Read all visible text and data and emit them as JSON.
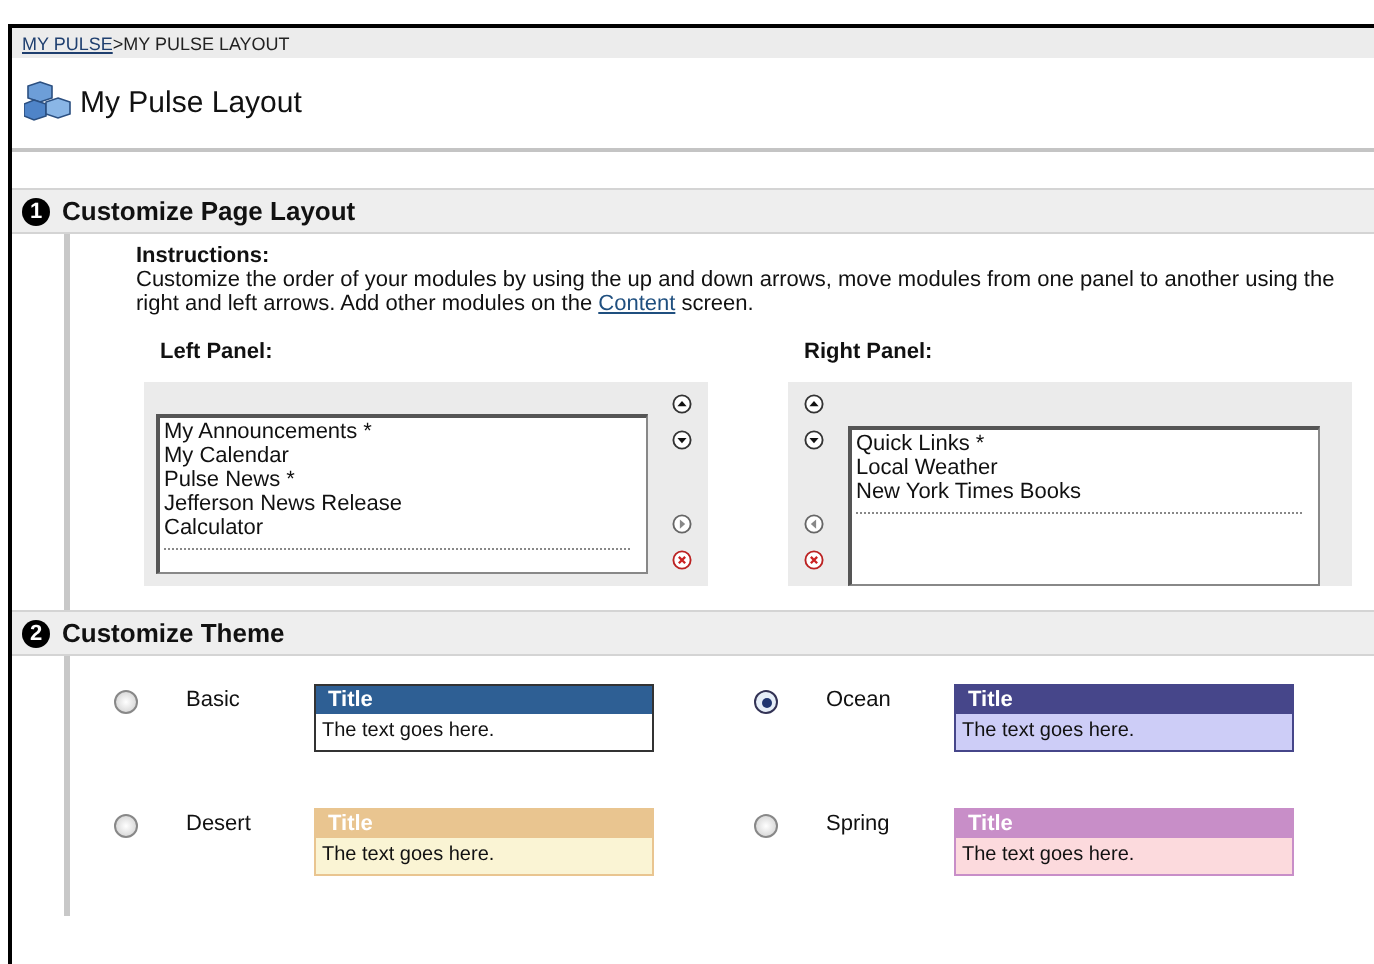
{
  "breadcrumb": [
    {
      "label": "MY PULSE",
      "link": true
    },
    {
      "label": ">MY PULSE LAYOUT",
      "link": false
    }
  ],
  "page_title": "My Pulse Layout",
  "sections": [
    {
      "number": "1",
      "title": "Customize Page Layout"
    },
    {
      "number": "2",
      "title": "Customize Theme"
    }
  ],
  "instructions": {
    "heading": "Instructions:",
    "text_before": "Customize the order of your modules by using the up and down arrows, move modules from one panel to another using the right and left arrows. Add other modules on the",
    "link": "Content",
    "text_after": "screen."
  },
  "panels": [
    {
      "label": "Left Panel:",
      "kind": "left",
      "items": [
        "My Announcements *",
        "My Calendar",
        "Pulse News *",
        "Jefferson News Release",
        "Calculator"
      ]
    },
    {
      "label": "Right Panel:",
      "kind": "right",
      "items": [
        "Quick Links *",
        "Local Weather",
        "New York Times Books"
      ]
    }
  ],
  "themes": [
    {
      "name": "Basic",
      "selected": false,
      "header": {
        "text": "Title",
        "color": "#2e5f94"
      },
      "body": {
        "text": "The text goes here.",
        "color": "#ffffff"
      }
    },
    {
      "name": "Ocean",
      "selected": true,
      "header": {
        "text": "Title",
        "color": "#46468a"
      },
      "body": {
        "text": "The text goes here.",
        "color": "#cdcdf7"
      }
    },
    {
      "name": "Desert",
      "selected": false,
      "header": {
        "text": "Title",
        "color": "#e9c590"
      },
      "body": {
        "text": "The text goes here.",
        "color": "#faf4d4"
      }
    },
    {
      "name": "Spring",
      "selected": false,
      "header": {
        "text": "Title",
        "color": "#c88ec8"
      },
      "body": {
        "text": "The text goes here.",
        "color": "#fcdadd"
      }
    }
  ]
}
